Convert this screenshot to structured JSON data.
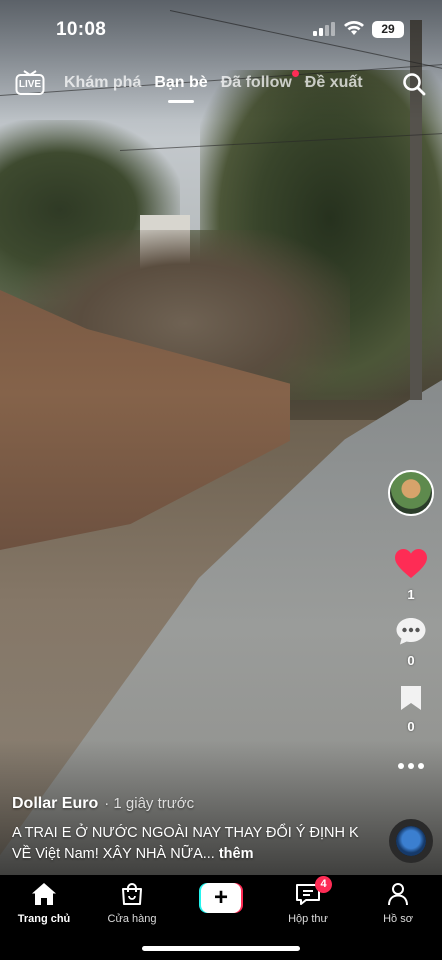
{
  "status_bar": {
    "time": "10:08",
    "battery": "29"
  },
  "top_nav": {
    "live_label": "LIVE",
    "tabs": [
      {
        "label": "Khám phá",
        "active": false
      },
      {
        "label": "Bạn bè",
        "active": true
      },
      {
        "label": "Đã follow",
        "active": false,
        "has_dot": true
      },
      {
        "label": "Đề xuất",
        "active": false
      }
    ]
  },
  "right_rail": {
    "likes": "1",
    "comments": "0",
    "saves": "0"
  },
  "post": {
    "author": "Dollar Euro",
    "time_ago": "· 1 giây trước",
    "caption": "A TRAI E Ở NƯỚC NGOÀI NAY THAY ĐỔI Ý ĐỊNH K VỀ Việt Nam! XÂY NHÀ NỮA...",
    "more_label": "thêm"
  },
  "tab_bar": {
    "items": [
      {
        "label": "Trang chủ",
        "icon": "home-icon",
        "active": true
      },
      {
        "label": "Cửa hàng",
        "icon": "shop-bag-icon",
        "active": false
      },
      {
        "label": "",
        "icon": "create-plus-icon",
        "active": false
      },
      {
        "label": "Hộp thư",
        "icon": "inbox-icon",
        "active": false
      },
      {
        "label": "Hồ sơ",
        "icon": "profile-icon",
        "active": false
      }
    ],
    "inbox_badge": "4"
  },
  "colors": {
    "accent_red": "#fe2c55",
    "accent_cyan": "#25f4ee",
    "like_red": "#fe2c55"
  }
}
